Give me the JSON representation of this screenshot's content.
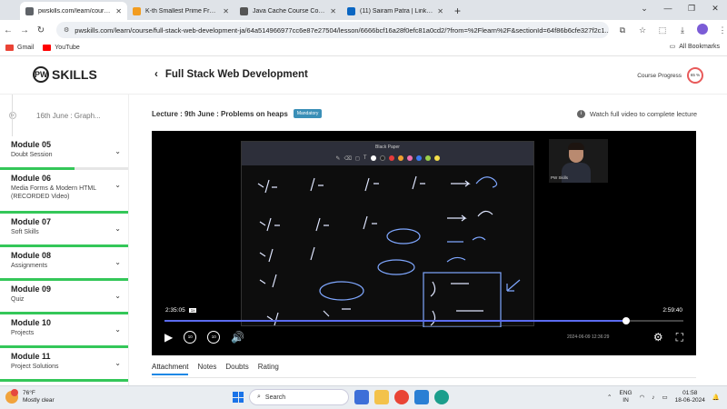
{
  "browser": {
    "tabs": [
      {
        "title": "pwskills.com/learn/course/full-s",
        "color": "#5f6368",
        "active": true
      },
      {
        "title": "K-th Smallest Prime Fraction - L",
        "color": "#f29c1f",
        "active": false
      },
      {
        "title": "Java Cache Course Completed",
        "color": "#555555",
        "active": false
      },
      {
        "title": "(11) Sairam Patra | LinkedIn",
        "color": "#0a66c2",
        "active": false
      }
    ],
    "url": "pwskills.com/learn/course/full-stack-web-development-ja/64a514966977cc6e87e27504/lesson/6666bcf16a28f0efc81a0cd2/?from=%2Flearn%2F&sectionId=64f86b6cfe327f2c1...",
    "bookmarks": [
      {
        "label": "Gmail",
        "color": "#ea4335"
      },
      {
        "label": "YouTube",
        "color": "#ff0000"
      }
    ],
    "all_bookmarks": "All Bookmarks"
  },
  "header": {
    "logo_text": "SKILLS",
    "title": "Full Stack Web Development",
    "progress_label": "Course Progress",
    "progress_value": "65 %"
  },
  "sidebar": {
    "current_lesson": "16th June : Graph...",
    "modules": [
      {
        "title": "Module 05",
        "subtitle": "Doubt Session",
        "progress": 0.58
      },
      {
        "title": "Module 06",
        "subtitle": "Media Forms & Modern HTML (RECORDED Video)",
        "progress": 1.0
      },
      {
        "title": "Module 07",
        "subtitle": "Soft Skills",
        "progress": 1.0
      },
      {
        "title": "Module 08",
        "subtitle": "Assignments",
        "progress": 1.0
      },
      {
        "title": "Module 09",
        "subtitle": "Quiz",
        "progress": 1.0
      },
      {
        "title": "Module 10",
        "subtitle": "Projects",
        "progress": 1.0
      },
      {
        "title": "Module 11",
        "subtitle": "Project Solutions",
        "progress": 1.0
      }
    ]
  },
  "lecture": {
    "title": "Lecture : 9th June : Problems on heaps",
    "badge": "Mandatory",
    "watch_note": "Watch full video to complete lecture"
  },
  "player": {
    "slide_title": "Black Paper",
    "camera_label": "PW Skills",
    "current_time": "2:35:05",
    "live_tag": "1x",
    "total_time": "2:59:40",
    "progress": 0.89,
    "timestamp": "2024-06-09 12:36:29",
    "rewind_label": "10",
    "forward_label": "10"
  },
  "content_tabs": [
    "Attachment",
    "Notes",
    "Doubts",
    "Rating"
  ],
  "taskbar": {
    "temperature": "76°F",
    "weather": "Mostly clear",
    "search_placeholder": "Search",
    "lang1": "ENG",
    "lang2": "IN",
    "time": "01:58",
    "date": "18-06-2024"
  }
}
